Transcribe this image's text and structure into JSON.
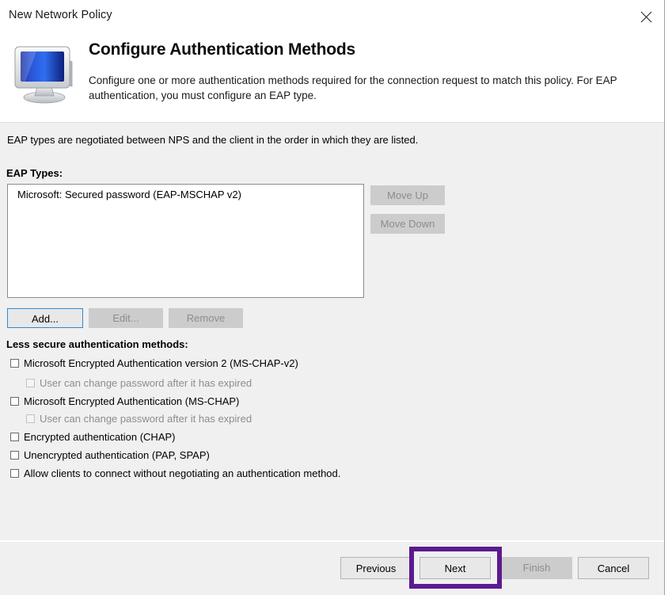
{
  "window": {
    "title": "New Network Policy",
    "close_icon": "close-icon"
  },
  "header": {
    "icon": "computer-monitor-icon",
    "title": "Configure Authentication Methods",
    "description": "Configure one or more authentication methods required for the connection request to match this policy. For EAP authentication, you must configure an EAP type."
  },
  "body": {
    "intro_text": "EAP types are negotiated between NPS and the client in the order in which they are listed.",
    "eap_types_label": "EAP Types:",
    "eap_types": [
      "Microsoft: Secured password (EAP-MSCHAP v2)"
    ],
    "move_up_label": "Move Up",
    "move_down_label": "Move Down",
    "add_label": "Add...",
    "edit_label": "Edit...",
    "remove_label": "Remove",
    "less_secure_label": "Less secure authentication methods:",
    "checkboxes": [
      {
        "label": "Microsoft Encrypted Authentication version 2 (MS-CHAP-v2)",
        "checked": false,
        "enabled": true,
        "indent": false
      },
      {
        "label": "User can change password after it has expired",
        "checked": false,
        "enabled": false,
        "indent": true
      },
      {
        "label": "Microsoft Encrypted Authentication (MS-CHAP)",
        "checked": false,
        "enabled": true,
        "indent": false
      },
      {
        "label": "User can change password after it has expired",
        "checked": false,
        "enabled": false,
        "indent": true
      },
      {
        "label": "Encrypted authentication (CHAP)",
        "checked": false,
        "enabled": true,
        "indent": false
      },
      {
        "label": "Unencrypted authentication (PAP, SPAP)",
        "checked": false,
        "enabled": true,
        "indent": false
      },
      {
        "label": "Allow clients to connect without negotiating an authentication method.",
        "checked": false,
        "enabled": true,
        "indent": false
      }
    ]
  },
  "footer": {
    "previous_label": "Previous",
    "next_label": "Next",
    "finish_label": "Finish",
    "cancel_label": "Cancel"
  },
  "annotation": {
    "target": "Next",
    "color": "#5c1a8f"
  },
  "colors": {
    "dialog_background": "#f0f0f0",
    "header_background": "#ffffff",
    "disabled_button": "#cccccc",
    "disabled_text": "#8d8d8d",
    "focus_border": "#2d8ad4",
    "annotation_purple": "#5c1a8f"
  }
}
